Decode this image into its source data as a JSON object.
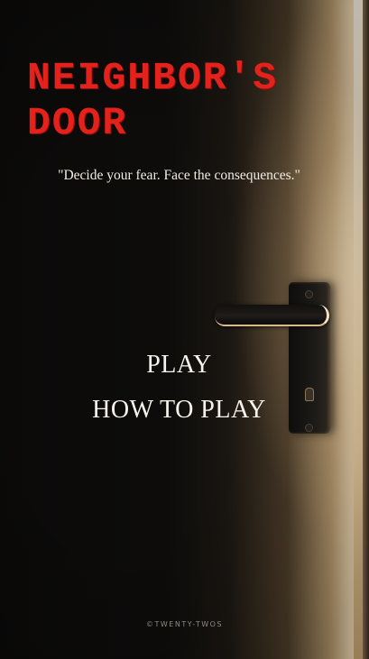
{
  "title": {
    "line1": "NEIGHBOR'S",
    "line2": "DOOR"
  },
  "tagline": "\"Decide your fear. Face the consequences.\"",
  "menu": {
    "play_label": "PLAY",
    "how_to_play_label": "HOW TO PLAY"
  },
  "footer": {
    "credit": "©TWENTY-TWOS"
  },
  "colors": {
    "title": "#e3221c",
    "menu_text": "#f7f3ec",
    "background": "#0a0908",
    "door_light": "#ffe9c4"
  }
}
